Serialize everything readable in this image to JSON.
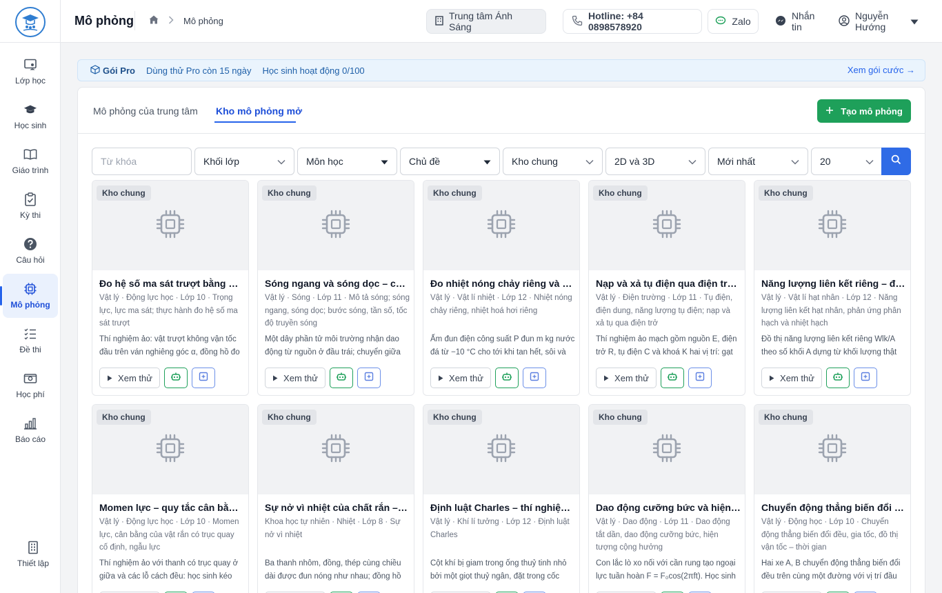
{
  "header": {
    "title": "Mô phỏng",
    "breadcrumb_current": "Mô phỏng",
    "center_name": "Trung tâm Ánh Sáng",
    "hotline": "Hotline: +84 0898578920",
    "zalo": "Zalo",
    "message": "Nhắn tin",
    "user_name": "Nguyễn Hướng"
  },
  "sidebar": {
    "items": [
      {
        "label": "Lớp học",
        "icon": "classroom-icon"
      },
      {
        "label": "Học sinh",
        "icon": "graduation-cap-icon"
      },
      {
        "label": "Giáo trình",
        "icon": "book-icon"
      },
      {
        "label": "Kỳ thi",
        "icon": "clipboard-check-icon"
      },
      {
        "label": "Câu hỏi",
        "icon": "question-icon"
      },
      {
        "label": "Mô phỏng",
        "icon": "chip-icon",
        "active": true
      },
      {
        "label": "Đề thi",
        "icon": "list-icon"
      },
      {
        "label": "Học phí",
        "icon": "wallet-icon"
      },
      {
        "label": "Báo cáo",
        "icon": "bar-chart-icon"
      }
    ],
    "settings": "Thiết lập"
  },
  "banner": {
    "pro_label": "Gói Pro",
    "trial": "Dùng thử Pro còn 15 ngày",
    "students": "Học sinh hoạt động 0/100",
    "more": "Xem gói cước →"
  },
  "tabs": [
    "Mô phỏng của trung tâm",
    "Kho mô phỏng mở"
  ],
  "active_tab": 1,
  "create_button": "Tạo mô phỏng",
  "filters": {
    "keyword_placeholder": "Từ khóa",
    "grade": "Khối lớp",
    "subject": "Môn học",
    "topic": "Chủ đề",
    "library": "Kho chung",
    "dimension": "2D và 3D",
    "sort": "Mới nhất",
    "page_size": "20"
  },
  "card_actions": {
    "try_label": "Xem thử"
  },
  "colors": {
    "primary": "#2563eb",
    "green": "#1ea05a",
    "banner_bg": "#eaf4fd"
  },
  "cards": [
    {
      "badge": "Kho chung",
      "title": "Đo hệ số ma sát trượt bằng mặt phẳng nghiêng",
      "meta": "Vật lý · Động lực học · Lớp 10 · Trọng lực, lực ma sát; thực hành đo hệ số ma sát trượt",
      "desc": "Thí nghiệm ảo: vật trượt không vận tốc đầu trên ván nghiêng góc α, đồng hồ đo thời gian"
    },
    {
      "badge": "Kho chung",
      "title": "Sóng ngang và sóng dọc – chuyển động của phần tử",
      "meta": "Vật lý · Sóng · Lớp 11 · Mô tả sóng; sóng ngang, sóng dọc; bước sóng, tần số, tốc độ truyền sóng",
      "desc": "Một dây phần tử môi trường nhận dao động từ nguồn ở đầu trái; chuyển giữa hai chế độ"
    },
    {
      "badge": "Kho chung",
      "title": "Đo nhiệt nóng chảy riêng và nhiệt hoá hơi riêng",
      "meta": "Vật lý · Vật lí nhiệt · Lớp 12 · Nhiệt nóng chảy riêng, nhiệt hoá hơi riêng",
      "desc": "Ấm đun điện công suất P đun m kg nước đá từ −10 °C cho tới khi tan hết, sôi và bay hơi"
    },
    {
      "badge": "Kho chung",
      "title": "Nạp và xả tụ điện qua điện trở R",
      "meta": "Vật lý · Điện trường · Lớp 11 · Tụ điện, điện dung, năng lượng tụ điện; nạp và xả tụ qua điện trở",
      "desc": "Thí nghiệm ảo mạch gồm nguồn E, điện trở R, tụ điện C và khoá K hai vị trí: gạt khoá"
    },
    {
      "badge": "Kho chung",
      "title": "Năng lượng liên kết riêng – đường cong Wlk/A",
      "meta": "Vật lý · Vật lí hạt nhân · Lớp 12 · Năng lượng liên kết hạt nhân, phản ứng phân hạch và nhiệt hạch",
      "desc": "Đồ thị năng lượng liên kết riêng Wlk/A theo số khối A dựng từ khối lượng thật"
    },
    {
      "badge": "Kho chung",
      "title": "Momen lực – quy tắc cân bằng thanh",
      "meta": "Vật lý · Động lực học · Lớp 10 · Momen lực, cân bằng của vật rắn có trục quay cố định, ngẫu lực",
      "desc": "Thí nghiệm ảo với thanh có trục quay ở giữa và các lỗ cách đều: học sinh kéo thả"
    },
    {
      "badge": "Kho chung",
      "title": "Sự nở vì nhiệt của chất rắn – thí nghiệm",
      "meta": "Khoa học tự nhiên · Nhiệt · Lớp 8 · Sự nở vì nhiệt",
      "desc": "Ba thanh nhôm, đồng, thép cùng chiều dài được đun nóng như nhau; đồng hồ đo độ dài"
    },
    {
      "badge": "Kho chung",
      "title": "Định luật Charles – thí nghiệm khí",
      "meta": "Vật lý · Khí lí tưởng · Lớp 12 · Định luật Charles",
      "desc": "Cột khí bị giam trong ống thuỷ tinh nhỏ bởi một giọt thuỷ ngân, đặt trong cốc nước"
    },
    {
      "badge": "Kho chung",
      "title": "Dao động cưỡng bức và hiện tượng cộng hưởng",
      "meta": "Vật lý · Dao động · Lớp 11 · Dao động tắt dần, dao động cưỡng bức, hiện tượng cộng hưởng",
      "desc": "Con lắc lò xo nối với cần rung tạo ngoại lực tuần hoàn F = F₀cos(2πft). Học sinh chỉnh"
    },
    {
      "badge": "Kho chung",
      "title": "Chuyển động thẳng biến đổi đều – đồ thị",
      "meta": "Vật lý · Động học · Lớp 10 · Chuyển động thẳng biến đổi đều, gia tốc, đồ thị vận tốc – thời gian",
      "desc": "Hai xe A, B chuyển động thẳng biến đổi đều trên cùng một đường với vị trí đầu"
    }
  ]
}
